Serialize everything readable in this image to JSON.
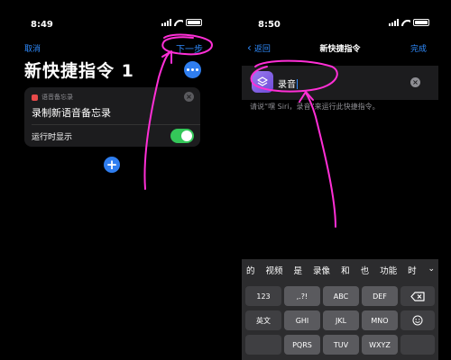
{
  "left": {
    "status": {
      "time": "8:49"
    },
    "nav": {
      "cancel": "取消",
      "next": "下一步"
    },
    "title": "新快捷指令 1",
    "card": {
      "app_name": "语音备忘录",
      "action": "录制新语音备忘录",
      "show_when_run_label": "运行时显示",
      "show_when_run": true
    },
    "add_icon": "plus-icon"
  },
  "right": {
    "status": {
      "time": "8:50"
    },
    "nav": {
      "back": "返回",
      "title": "新快捷指令",
      "done": "完成"
    },
    "name_field": {
      "value": "录音",
      "icon": "layers-icon"
    },
    "hint": "请说“嘿 Siri，录音”来运行此快捷指令。",
    "keyboard": {
      "candidates": [
        "的",
        "视频",
        "是",
        "录像",
        "和",
        "也",
        "功能",
        "时"
      ],
      "row2": [
        "123",
        ",.?!",
        "ABC",
        "DEF"
      ],
      "row3": [
        "英文",
        "GHI",
        "JKL",
        "MNO"
      ],
      "row4": [
        "PQRS",
        "TUV",
        "WXYZ"
      ]
    }
  },
  "colors": {
    "accent": "#2f8cff",
    "toggle_on": "#34c759",
    "annotation": "#ff2fd6"
  }
}
